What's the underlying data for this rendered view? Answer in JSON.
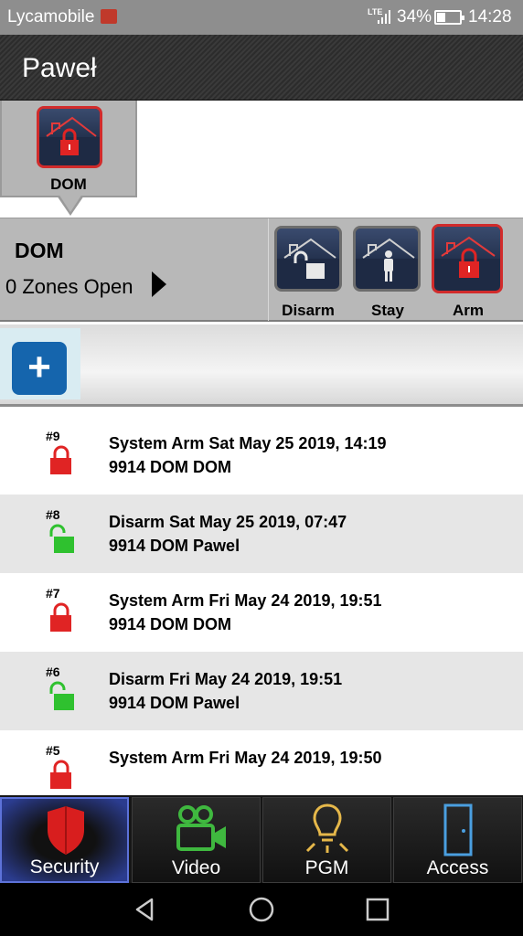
{
  "status_bar": {
    "carrier": "Lycamobile",
    "network": "LTE",
    "battery": "34%",
    "time": "14:28"
  },
  "header": {
    "title": "Paweł"
  },
  "partition_tab": {
    "label": "DOM",
    "icon": "house-armed-icon"
  },
  "status_panel": {
    "partition_name": "DOM",
    "zones_open": "0 Zones Open",
    "modes": [
      {
        "label": "Disarm",
        "icon": "house-unlocked-icon",
        "active": false
      },
      {
        "label": "Stay",
        "icon": "house-person-icon",
        "active": false
      },
      {
        "label": "Arm",
        "icon": "house-locked-icon",
        "active": true
      }
    ]
  },
  "toolbar": {
    "add_label": "+"
  },
  "events": [
    {
      "num": "#9",
      "state": "armed",
      "line1": "System Arm Sat May 25 2019, 14:19",
      "line2": "9914 DOM DOM"
    },
    {
      "num": "#8",
      "state": "disarmed",
      "line1": "Disarm Sat May 25 2019, 07:47",
      "line2": "9914 DOM Pawel"
    },
    {
      "num": "#7",
      "state": "armed",
      "line1": "System Arm Fri May 24 2019, 19:51",
      "line2": "9914 DOM DOM"
    },
    {
      "num": "#6",
      "state": "disarmed",
      "line1": "Disarm Fri May 24 2019, 19:51",
      "line2": "9914 DOM Pawel"
    },
    {
      "num": "#5",
      "state": "armed",
      "line1": "System Arm Fri May 24 2019, 19:50",
      "line2": ""
    }
  ],
  "bottom_nav": [
    {
      "label": "Security",
      "icon": "shield-icon",
      "active": true
    },
    {
      "label": "Video",
      "icon": "video-camera-icon",
      "active": false
    },
    {
      "label": "PGM",
      "icon": "light-bulb-icon",
      "active": false
    },
    {
      "label": "Access",
      "icon": "door-icon",
      "active": false
    }
  ],
  "colors": {
    "armed": "#e02424",
    "disarmed": "#2fc12f",
    "accent_blue": "#1565ad",
    "active_nav": "#5d72d9"
  }
}
